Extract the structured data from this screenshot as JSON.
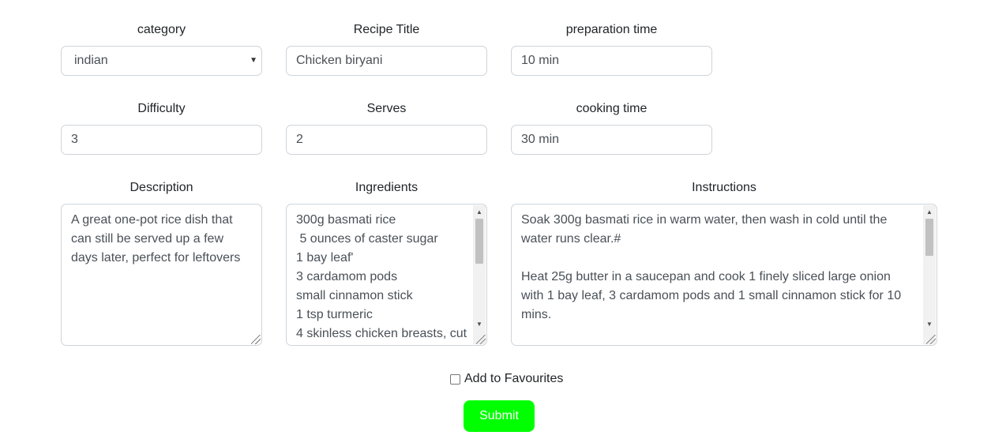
{
  "form": {
    "category": {
      "label": "category",
      "value": "indian"
    },
    "title": {
      "label": "Recipe Title",
      "value": "Chicken biryani"
    },
    "prep_time": {
      "label": "preparation time",
      "value": "10 min"
    },
    "difficulty": {
      "label": "Difficulty",
      "value": "3"
    },
    "serves": {
      "label": "Serves",
      "value": "2"
    },
    "cooking_time": {
      "label": "cooking time",
      "value": "30 min"
    },
    "description": {
      "label": "Description",
      "value": "A great one-pot rice dish that can still be served up a few days later, perfect for leftovers"
    },
    "ingredients": {
      "label": "Ingredients",
      "value": "300g basmati rice\n 5 ounces of caster sugar\n1 bay leaf'\n3 cardamom pods\nsmall cinnamon stick\n1 tsp turmeric\n4 skinless chicken breasts, cut"
    },
    "instructions": {
      "label": "Instructions",
      "value": "Soak 300g basmati rice in warm water, then wash in cold until the water runs clear.#\n\nHeat 25g butter in a saucepan and cook 1 finely sliced large onion with 1 bay leaf, 3 cardamom pods and 1 small cinnamon stick for 10 mins."
    },
    "favourites_label": "Add to Favourites",
    "submit_label": "Submit"
  },
  "colors": {
    "submit_bg": "#00ff00",
    "submit_text": "#ffffff",
    "input_border": "#ced4da"
  },
  "icons": {
    "select_arrow": "chevron-down-icon",
    "scroll_up": "scroll-up-icon",
    "scroll_down": "scroll-down-icon",
    "resize": "resize-handle-icon"
  }
}
